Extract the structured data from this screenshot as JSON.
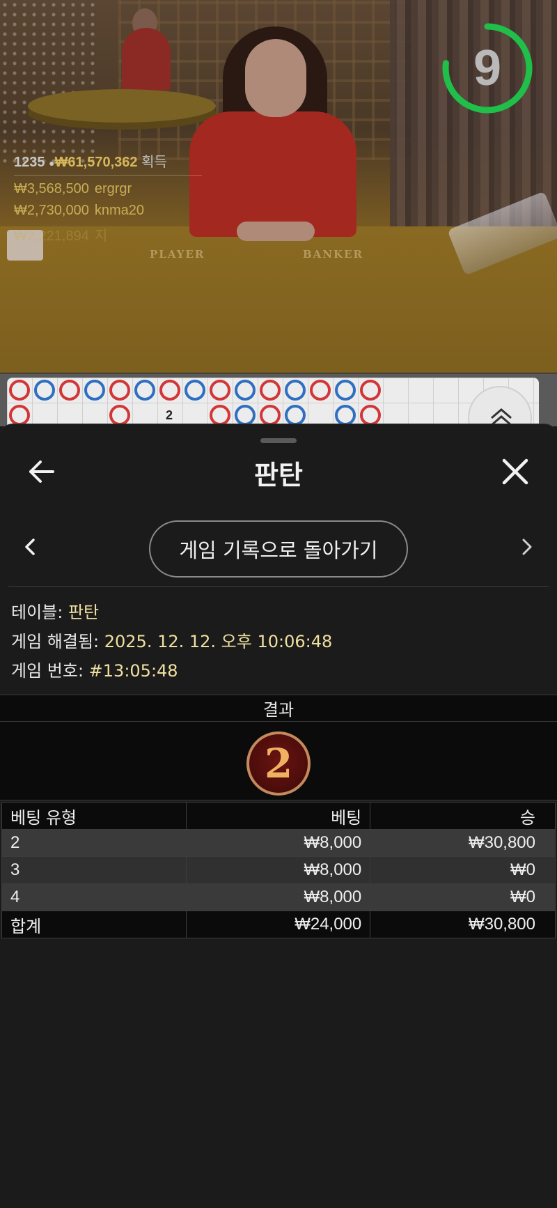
{
  "video": {
    "timer": "9",
    "felt_labels": [
      "PLAYER",
      "BANKER"
    ],
    "winners_summary": {
      "count": "1235",
      "total": "₩61,570,362",
      "label": "획득"
    },
    "winners": [
      {
        "amount": "₩3,568,500",
        "name": "ergrgr"
      },
      {
        "amount": "₩2,730,000",
        "name": "knma20"
      },
      {
        "amount": "₩2,221,894",
        "name": "지"
      }
    ]
  },
  "roadmap": {
    "top_row": [
      "r",
      "b",
      "r",
      "b",
      "r",
      "b",
      "r",
      "b",
      "r",
      "b",
      "r",
      "b",
      "r",
      "b",
      "r"
    ],
    "bottom_row": [
      "r",
      "",
      "",
      "",
      "r",
      "",
      "2",
      "",
      "r",
      "b",
      "r",
      "b",
      "",
      "b",
      "r"
    ]
  },
  "sheet": {
    "title": "판탄",
    "back_to_history": "게임 기록으로 돌아가기",
    "info": {
      "table_label": "테이블: ",
      "table_value": "판탄",
      "resolved_label": "게임 해결됨: ",
      "resolved_value": "2025. 12. 12. 오후 10:06:48",
      "game_no_label": "게임 번호: ",
      "game_no_value": "#13:05:48"
    },
    "result": {
      "header": "결과",
      "value": "2"
    },
    "table": {
      "headers": [
        "베팅 유형",
        "베팅",
        "승"
      ],
      "rows": [
        [
          "2",
          "₩8,000",
          "₩30,800"
        ],
        [
          "3",
          "₩8,000",
          "₩0"
        ],
        [
          "4",
          "₩8,000",
          "₩0"
        ]
      ],
      "total": [
        "합계",
        "₩24,000",
        "₩30,800"
      ]
    }
  },
  "colors": {
    "accent_gold": "#f0e0a0",
    "timer_green": "#1fbf4a",
    "banker_red": "#d23636",
    "player_blue": "#2f6fc2"
  }
}
